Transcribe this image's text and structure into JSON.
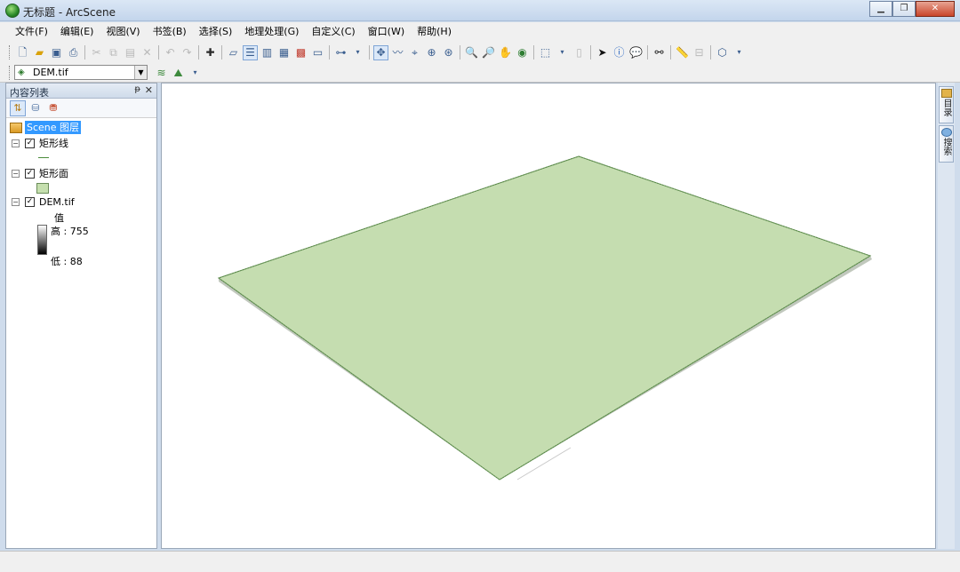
{
  "window": {
    "title": "无标题 - ArcScene",
    "minimize": "▁",
    "restore": "❐",
    "close": "✕"
  },
  "menu": [
    "文件(F)",
    "编辑(E)",
    "视图(V)",
    "书签(B)",
    "选择(S)",
    "地理处理(G)",
    "自定义(C)",
    "窗口(W)",
    "帮助(H)"
  ],
  "toolbar2": {
    "layer_value": "DEM.tif"
  },
  "toc": {
    "title": "内容列表",
    "pin": "ᵽ",
    "close": "✕",
    "scene_label": "Scene 图层",
    "layers": [
      {
        "name": "矩形线",
        "checked": "✓",
        "expander": "−"
      },
      {
        "name": "矩形面",
        "checked": "✓",
        "expander": "−"
      },
      {
        "name": "DEM.tif",
        "checked": "✓",
        "expander": "−"
      }
    ],
    "dem_legend": {
      "field": "值",
      "high": "高 : 755",
      "low": "低 : 88"
    }
  },
  "dock": {
    "tab1": "目录",
    "tab2": "搜索"
  },
  "colors": {
    "surface_fill": "#c5ddb0",
    "surface_edge": "#6e9a5d",
    "selection": "#3399ff"
  }
}
